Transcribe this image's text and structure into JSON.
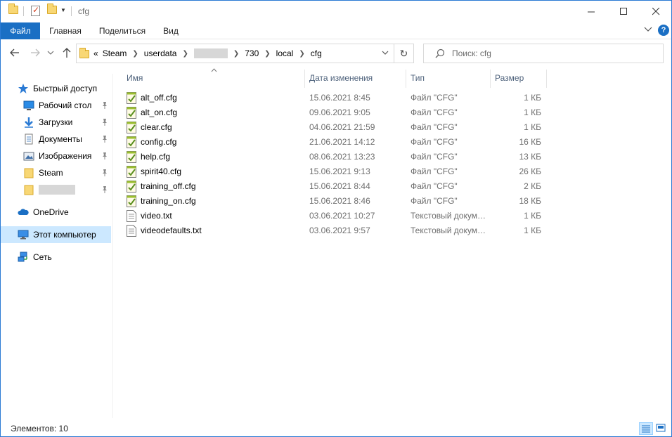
{
  "window": {
    "title": "cfg",
    "accent": "#1a6fc4"
  },
  "ribbon": {
    "tabs": [
      "Файл",
      "Главная",
      "Поделиться",
      "Вид"
    ]
  },
  "address": {
    "prefix": "«",
    "crumbs": [
      "Steam",
      "userdata",
      "",
      "730",
      "local",
      "cfg"
    ]
  },
  "search": {
    "placeholder": "Поиск: cfg"
  },
  "navpane": {
    "quick_access": "Быстрый доступ",
    "items": [
      {
        "label": "Рабочий стол",
        "icon": "desktop-icon",
        "pinned": true
      },
      {
        "label": "Загрузки",
        "icon": "downloads-icon",
        "pinned": true
      },
      {
        "label": "Документы",
        "icon": "documents-icon",
        "pinned": true
      },
      {
        "label": "Изображения",
        "icon": "pictures-icon",
        "pinned": true
      },
      {
        "label": "Steam",
        "icon": "folder-icon",
        "pinned": true
      },
      {
        "label": "",
        "icon": "folder-icon",
        "pinned": true
      }
    ],
    "onedrive": "OneDrive",
    "this_pc": "Этот компьютер",
    "network": "Сеть"
  },
  "columns": {
    "name": "Имя",
    "date": "Дата изменения",
    "type": "Тип",
    "size": "Размер"
  },
  "files": [
    {
      "name": "alt_off.cfg",
      "date": "15.06.2021 8:45",
      "type": "Файл \"CFG\"",
      "size": "1 КБ",
      "icon": "cfg-file-icon"
    },
    {
      "name": "alt_on.cfg",
      "date": "09.06.2021 9:05",
      "type": "Файл \"CFG\"",
      "size": "1 КБ",
      "icon": "cfg-file-icon"
    },
    {
      "name": "clear.cfg",
      "date": "04.06.2021 21:59",
      "type": "Файл \"CFG\"",
      "size": "1 КБ",
      "icon": "cfg-file-icon"
    },
    {
      "name": "config.cfg",
      "date": "21.06.2021 14:12",
      "type": "Файл \"CFG\"",
      "size": "16 КБ",
      "icon": "cfg-file-icon"
    },
    {
      "name": "help.cfg",
      "date": "08.06.2021 13:23",
      "type": "Файл \"CFG\"",
      "size": "13 КБ",
      "icon": "cfg-file-icon"
    },
    {
      "name": "spirit40.cfg",
      "date": "15.06.2021 9:13",
      "type": "Файл \"CFG\"",
      "size": "26 КБ",
      "icon": "cfg-file-icon"
    },
    {
      "name": "training_off.cfg",
      "date": "15.06.2021 8:44",
      "type": "Файл \"CFG\"",
      "size": "2 КБ",
      "icon": "cfg-file-icon"
    },
    {
      "name": "training_on.cfg",
      "date": "15.06.2021 8:46",
      "type": "Файл \"CFG\"",
      "size": "18 КБ",
      "icon": "cfg-file-icon"
    },
    {
      "name": "video.txt",
      "date": "03.06.2021 10:27",
      "type": "Текстовый документ",
      "size": "1 КБ",
      "icon": "text-file-icon"
    },
    {
      "name": "videodefaults.txt",
      "date": "03.06.2021 9:57",
      "type": "Текстовый документ",
      "size": "1 КБ",
      "icon": "text-file-icon"
    }
  ],
  "status": {
    "items": "Элементов: 10"
  }
}
